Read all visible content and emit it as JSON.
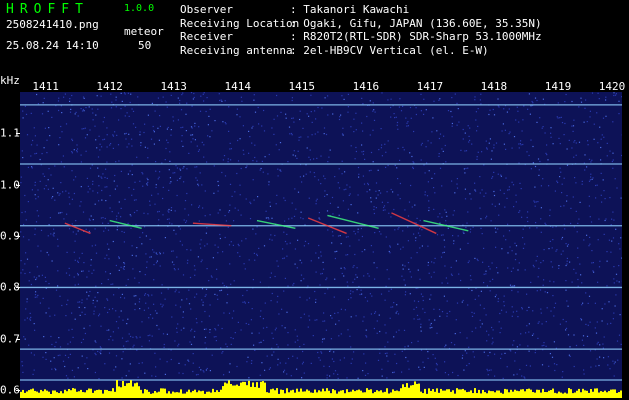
{
  "app": {
    "title": "HROFFT",
    "version": "1.0.0"
  },
  "capture": {
    "filename": "2508241410.png",
    "datetime": "25.08.24 14:10",
    "meteor_label": "meteor",
    "meteor_count": "50"
  },
  "meta": [
    {
      "key": "Observer",
      "value": "Takanori Kawachi"
    },
    {
      "key": "Receiving Location",
      "value": "Ogaki, Gifu, JAPAN (136.60E, 35.35N)"
    },
    {
      "key": "Receiver",
      "value": "R820T2(RTL-SDR) SDR-Sharp 53.1000MHz"
    },
    {
      "key": "Receiving antenna",
      "value": "2el-HB9CV Vertical (el. E-W)"
    }
  ],
  "chart_data": {
    "type": "heatmap",
    "yunit": "kHz",
    "x_ticks": [
      "1411",
      "1412",
      "1413",
      "1414",
      "1415",
      "1416",
      "1417",
      "1418",
      "1419",
      "1420"
    ],
    "x_range": [
      1410.6,
      1420
    ],
    "y_ticks": [
      "1.1",
      "1.0",
      "0.9",
      "0.8",
      "0.7",
      "0.6"
    ],
    "y_range": [
      0.585,
      1.18
    ],
    "horizontal_lines_khz": [
      1.155,
      1.04,
      0.92,
      0.8,
      0.68,
      0.62
    ],
    "colors": {
      "background": "#0d1257",
      "noise": "#2a3ab0",
      "line": "#8fd0ff",
      "echo": "#ff4040",
      "echo2": "#40ff80",
      "bars": "#ffff00"
    }
  }
}
